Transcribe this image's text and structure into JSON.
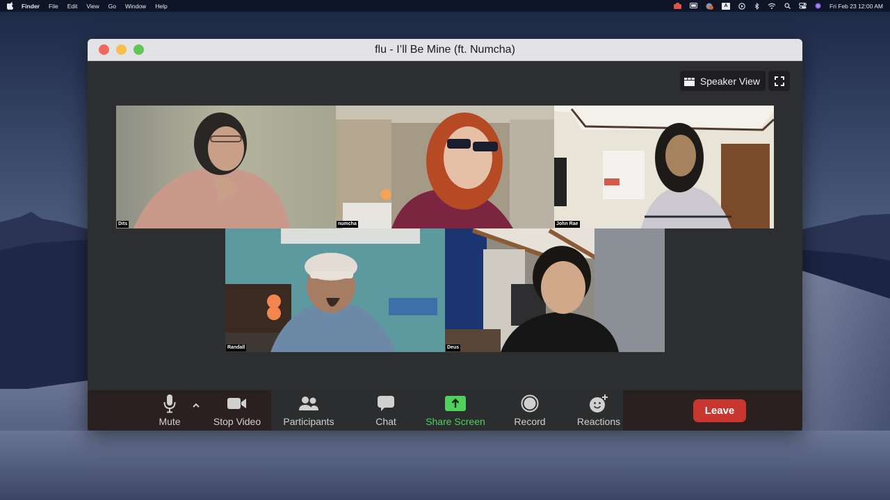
{
  "menubar": {
    "apple_icon": "apple-logo",
    "items": [
      "Finder",
      "File",
      "Edit",
      "View",
      "Go",
      "Window",
      "Help"
    ],
    "status_icons": [
      "app-red-icon",
      "display-icon",
      "app-badge-icon",
      "input-source-icon",
      "play-circle-icon",
      "bluetooth-icon",
      "wifi-icon",
      "spotlight-search-icon",
      "control-center-icon",
      "siri-icon"
    ],
    "input_source": "A",
    "clock": "Fri Feb 23  12:00 AM"
  },
  "window": {
    "title": "flu - I’ll Be Mine (ft. Numcha)",
    "view_button": "Speaker View",
    "colors": {
      "titlebar": "#e3e3e5",
      "body": "#2d2e30",
      "close": "#ee6a5f",
      "minimize": "#f5be4f",
      "maximize": "#62c554"
    }
  },
  "participants": [
    {
      "name": "Dits"
    },
    {
      "name": "numcha"
    },
    {
      "name": "John Rae"
    },
    {
      "name": "Randall"
    },
    {
      "name": "Deus"
    }
  ],
  "toolbar": {
    "mute": "Mute",
    "stop_video": "Stop Video",
    "participants": "Participants",
    "chat": "Chat",
    "share_screen": "Share Screen",
    "record": "Record",
    "reactions": "Reactions",
    "leave": "Leave",
    "colors": {
      "share_screen": "#4fd15c",
      "leave": "#c8362f"
    }
  }
}
